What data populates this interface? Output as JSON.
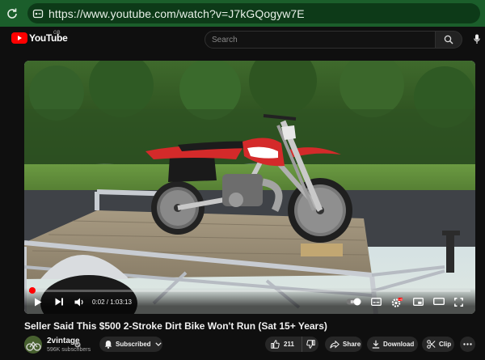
{
  "browser": {
    "url": "https://www.youtube.com/watch?v=J7kGQogyw7E",
    "icons": {
      "reload": "reload-icon",
      "site_info": "site-info-icon"
    }
  },
  "header": {
    "logo_text": "YouTube",
    "region": "GB",
    "search_placeholder": "Search",
    "icons": {
      "search": "search-icon",
      "mic": "mic-icon"
    }
  },
  "player": {
    "time_current": "0:02",
    "time_total": "1:03:13",
    "time_display": "0:02 / 1:03:13",
    "progress_fraction": 0.0005,
    "accent_color": "#ff0000",
    "controls": [
      "play-icon",
      "next-icon",
      "volume-icon",
      "autoplay-toggle",
      "subtitles-icon",
      "settings-icon",
      "miniplayer-icon",
      "theater-icon",
      "fullscreen-icon"
    ]
  },
  "video": {
    "title": "Seller Said This $500 2-Stroke Dirt Bike Won't Run (Sat 15+ Years)"
  },
  "channel": {
    "name": "2vintage",
    "subscribers": "596K subscribers"
  },
  "actions": {
    "subscribed_label": "Subscribed",
    "like_count": "211",
    "share_label": "Share",
    "download_label": "Download",
    "clip_label": "Clip"
  }
}
